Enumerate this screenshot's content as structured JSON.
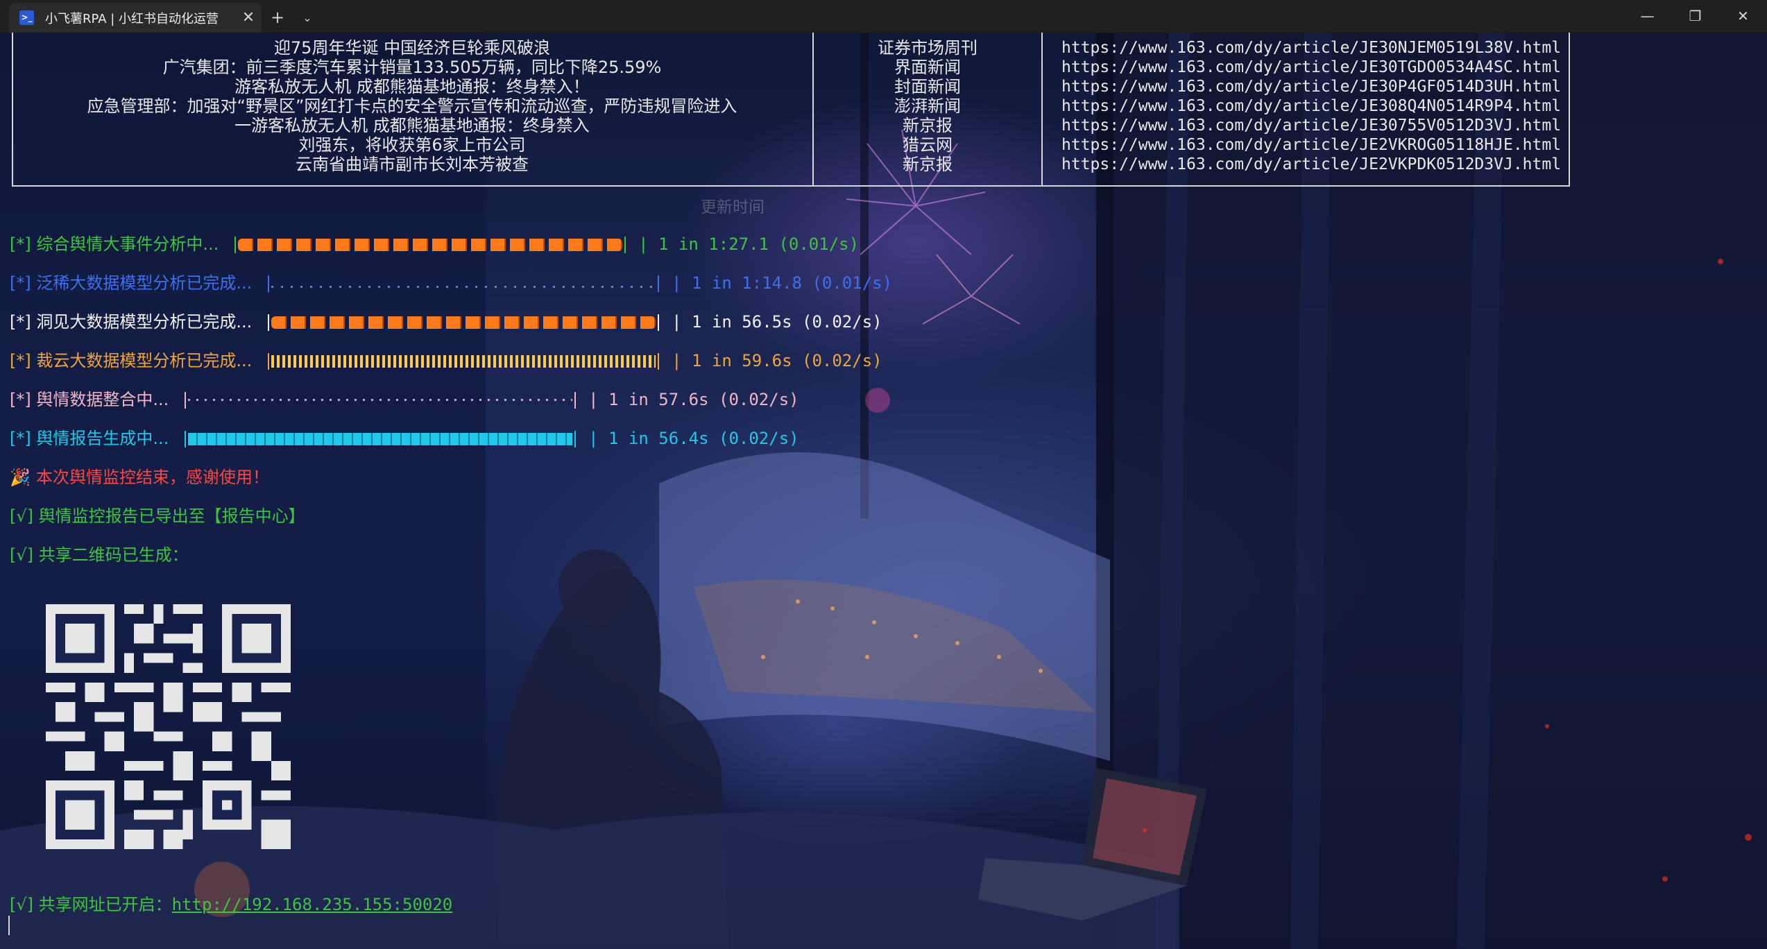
{
  "window": {
    "tab_title": "小飞薯RPA | 小红书自动化运营",
    "tab_icon": "powershell-icon",
    "new_tab_symbol": "+",
    "dropdown_symbol": "⌄",
    "close_tab_symbol": "✕",
    "minimize_symbol": "—",
    "maximize_symbol": "❐",
    "close_symbol": "✕"
  },
  "news_table": {
    "titles": [
      "迎75周年华诞 中国经济巨轮乘风破浪",
      "广汽集团：前三季度汽车累计销量133.505万辆，同比下降25.59%",
      "游客私放无人机 成都熊猫基地通报：终身禁入！",
      "应急管理部：加强对“野景区”网红打卡点的安全警示宣传和流动巡查，严防违规冒险进入",
      "一游客私放无人机 成都熊猫基地通报：终身禁入",
      "刘强东，将收获第6家上市公司",
      "云南省曲靖市副市长刘本芳被查"
    ],
    "sources": [
      "证券市场周刊",
      "界面新闻",
      "封面新闻",
      "澎湃新闻",
      "新京报",
      "猎云网",
      "新京报"
    ],
    "links": [
      "https://www.163.com/dy/article/JE30NJEM0519L38V.html",
      "https://www.163.com/dy/article/JE30TGDO0534A4SC.html",
      "https://www.163.com/dy/article/JE30P4GF0514D3UH.html",
      "https://www.163.com/dy/article/JE308Q4N0514R9P4.html",
      "https://www.163.com/dy/article/JE30755V0512D3VJ.html",
      "https://www.163.com/dy/article/JE2VKROG05118HJE.html",
      "https://www.163.com/dy/article/JE2VKPDK0512D3VJ.html"
    ]
  },
  "update_time": "更新时间",
  "progress": [
    {
      "label": "[*] 综合舆情大事件分析中...",
      "stat": "| 1 in 1:27.1 (0.01/s)",
      "style": "pumpkin",
      "color": "#3ec43e"
    },
    {
      "label": "[*] 泛稀大数据模型分析已完成...",
      "stat": "| 1 in 1:14.8 (0.01/s)",
      "style": "dots",
      "color": "#3f6ff0"
    },
    {
      "label": "[*] 洞见大数据模型分析已完成...",
      "stat": "| 1 in 56.5s (0.02/s)",
      "style": "pumpkin",
      "color": "#f2f2f2"
    },
    {
      "label": "[*] 裁云大数据模型分析已完成...",
      "stat": "| 1 in 59.6s (0.02/s)",
      "style": "music",
      "color": "#f0a53a"
    },
    {
      "label": "[*] 舆情数据整合中...",
      "stat": "| 1 in 57.6s (0.02/s)",
      "style": "wave",
      "color": "#f3b4c8"
    },
    {
      "label": "[*] 舆情报告生成中...",
      "stat": "| 1 in 56.4s (0.02/s)",
      "style": "block",
      "color": "#20c8ea"
    }
  ],
  "messages": {
    "end": "本次舆情监控结束，感谢使用！",
    "exported": "[√] 舆情监控报告已导出至【报告中心】",
    "qr_generated": "[√] 共享二维码已生成：",
    "share_prefix": "[√] 共享网址已开启：",
    "share_url": "http://192.168.235.155:50020"
  },
  "colors": {
    "green": "#3ec43e",
    "blue": "#3f6ff0",
    "white": "#f2f2f2",
    "orange": "#f0a53a",
    "pink": "#f3b4c8",
    "cyan": "#20c8ea",
    "red": "#ff4444"
  },
  "icons": {
    "party": "party-popper-icon",
    "qr": "qr-code-icon"
  }
}
